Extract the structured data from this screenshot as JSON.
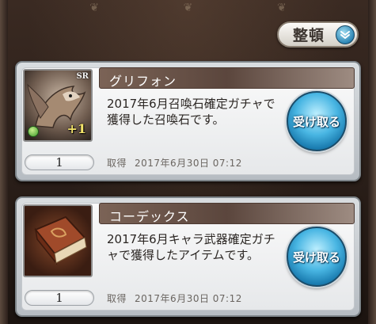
{
  "header": {
    "sort_label": "整頓",
    "sort_icon": "chevron-down-icon"
  },
  "items": [
    {
      "name": "グリフォン",
      "description": "2017年6月召喚石確定ガチャで獲得した召喚石です。",
      "quantity": "1",
      "acquired_label": "取得",
      "acquired_date": "2017年6月30日 07:12",
      "claim_label": "受け取る",
      "rarity_badge": "SR",
      "uncap_label": "+1",
      "thumb_icon": "griffon-summon-icon",
      "element_icon": "wind-element-icon"
    },
    {
      "name": "コーデックス",
      "description": "2017年6月キャラ武器確定ガチャで獲得したアイテムです。",
      "quantity": "1",
      "acquired_label": "取得",
      "acquired_date": "2017年6月30日 07:12",
      "claim_label": "受け取る",
      "thumb_icon": "codex-book-icon"
    }
  ],
  "colors": {
    "title_bar": "#6b5448",
    "claim_button": "#49b6e3",
    "background": "#2a1d18"
  }
}
